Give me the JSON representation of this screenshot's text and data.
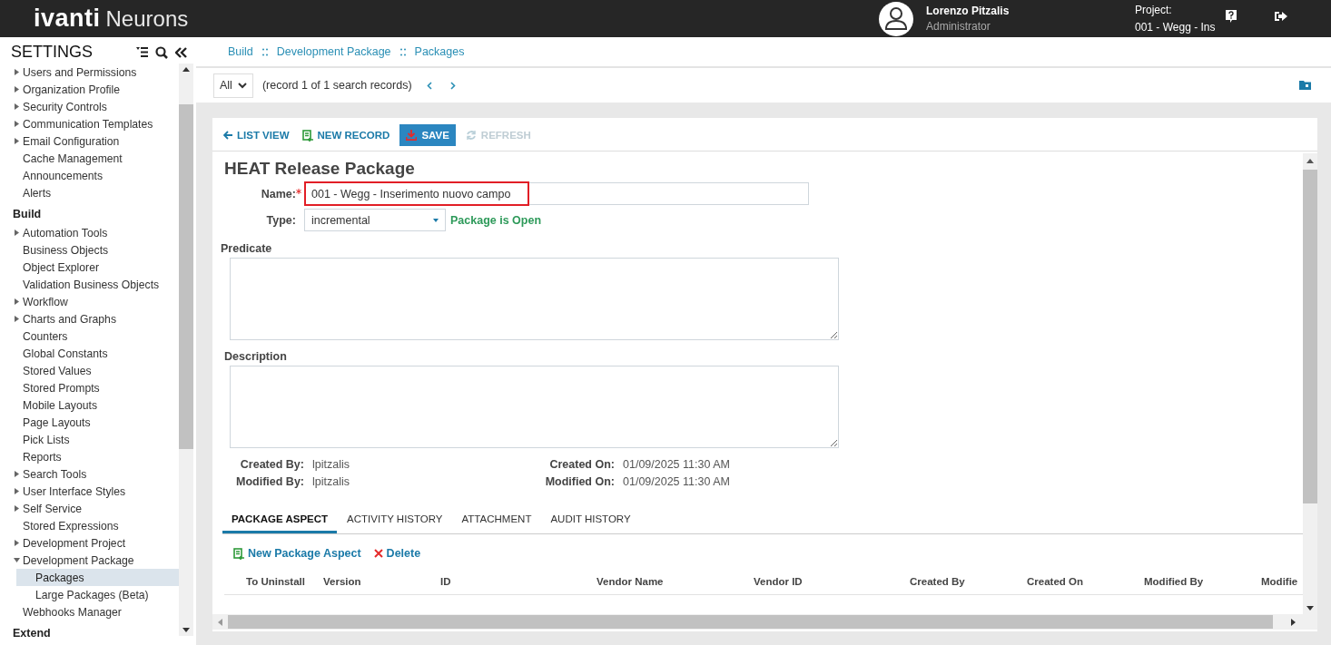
{
  "header": {
    "brand": "ivanti",
    "product": "Neurons",
    "user": {
      "name": "Lorenzo Pitzalis",
      "role": "Administrator"
    },
    "project": {
      "label": "Project:",
      "value": "001 - Wegg - Ins"
    }
  },
  "sidebar": {
    "title": "SETTINGS",
    "items": [
      {
        "kind": "folder",
        "label": "Users and Permissions",
        "expanded": false,
        "selected": false
      },
      {
        "kind": "folder",
        "label": "Organization Profile",
        "expanded": false,
        "selected": false
      },
      {
        "kind": "folder",
        "label": "Security Controls",
        "expanded": false,
        "selected": false
      },
      {
        "kind": "folder",
        "label": "Communication Templates",
        "expanded": false,
        "selected": false
      },
      {
        "kind": "folder",
        "label": "Email Configuration",
        "expanded": false,
        "selected": false
      },
      {
        "kind": "leaf",
        "label": "Cache Management",
        "selected": false
      },
      {
        "kind": "leaf",
        "label": "Announcements",
        "selected": false
      },
      {
        "kind": "leaf",
        "label": "Alerts",
        "selected": false
      },
      {
        "kind": "heading",
        "label": "Build"
      },
      {
        "kind": "folder",
        "label": "Automation Tools",
        "expanded": false,
        "selected": false
      },
      {
        "kind": "leaf",
        "label": "Business Objects",
        "selected": false
      },
      {
        "kind": "leaf",
        "label": "Object Explorer",
        "selected": false
      },
      {
        "kind": "leaf",
        "label": "Validation Business Objects",
        "selected": false
      },
      {
        "kind": "folder",
        "label": "Workflow",
        "expanded": false,
        "selected": false
      },
      {
        "kind": "folder",
        "label": "Charts and Graphs",
        "expanded": false,
        "selected": false
      },
      {
        "kind": "leaf",
        "label": "Counters",
        "selected": false
      },
      {
        "kind": "leaf",
        "label": "Global Constants",
        "selected": false
      },
      {
        "kind": "leaf",
        "label": "Stored Values",
        "selected": false
      },
      {
        "kind": "leaf",
        "label": "Stored Prompts",
        "selected": false
      },
      {
        "kind": "leaf",
        "label": "Mobile Layouts",
        "selected": false
      },
      {
        "kind": "leaf",
        "label": "Page Layouts",
        "selected": false
      },
      {
        "kind": "leaf",
        "label": "Pick Lists",
        "selected": false
      },
      {
        "kind": "leaf",
        "label": "Reports",
        "selected": false
      },
      {
        "kind": "folder",
        "label": "Search Tools",
        "expanded": false,
        "selected": false
      },
      {
        "kind": "folder",
        "label": "User Interface Styles",
        "expanded": false,
        "selected": false
      },
      {
        "kind": "folder",
        "label": "Self Service",
        "expanded": false,
        "selected": false
      },
      {
        "kind": "leaf",
        "label": "Stored Expressions",
        "selected": false
      },
      {
        "kind": "folder",
        "label": "Development Project",
        "expanded": false,
        "selected": false
      },
      {
        "kind": "folder",
        "label": "Development Package",
        "expanded": true,
        "selected": false,
        "children": [
          {
            "label": "Packages",
            "selected": true
          },
          {
            "label": "Large Packages (Beta)",
            "selected": false
          }
        ]
      },
      {
        "kind": "leaf",
        "label": "Webhooks Manager",
        "selected": false
      },
      {
        "kind": "heading",
        "label": "Extend"
      }
    ]
  },
  "breadcrumbs": [
    "Build",
    "Development Package",
    "Packages"
  ],
  "record_bar": {
    "filter": "All",
    "status": "(record 1 of 1 search records)"
  },
  "toolbar": [
    {
      "kind": "back",
      "label": "LIST VIEW",
      "disabled": false
    },
    {
      "kind": "new",
      "label": "NEW RECORD",
      "disabled": false
    },
    {
      "kind": "save",
      "label": "SAVE",
      "disabled": false
    },
    {
      "kind": "refresh",
      "label": "REFRESH",
      "disabled": true
    }
  ],
  "form": {
    "title": "HEAT Release Package",
    "name": {
      "label": "Name:",
      "required": true,
      "value": "001 - Wegg - Inserimento nuovo campo",
      "highlighted": true
    },
    "type": {
      "label": "Type:",
      "value": "incremental"
    },
    "status": "Package is Open",
    "predicate": {
      "label": "Predicate"
    },
    "description": {
      "label": "Description"
    },
    "meta": [
      {
        "label": "Created By:",
        "value": "lpitzalis"
      },
      {
        "label": "Created On:",
        "value": "01/09/2025 11:30 AM"
      },
      {
        "label": "Modified By:",
        "value": "lpitzalis"
      },
      {
        "label": "Modified On:",
        "value": "01/09/2025 11:30 AM"
      }
    ]
  },
  "tabs": [
    {
      "label": "PACKAGE ASPECT",
      "selected": true
    },
    {
      "label": "ACTIVITY HISTORY",
      "selected": false
    },
    {
      "label": "ATTACHMENT",
      "selected": false
    },
    {
      "label": "AUDIT HISTORY",
      "selected": false
    }
  ],
  "grid_actions": [
    {
      "kind": "new",
      "label": "New Package Aspect"
    },
    {
      "kind": "delete",
      "label": "Delete"
    }
  ],
  "table": {
    "columns": [
      "To Uninstall",
      "Version",
      "ID",
      "Vendor Name",
      "Vendor ID",
      "Created By",
      "Created On",
      "Modified By",
      "Modifie"
    ]
  }
}
